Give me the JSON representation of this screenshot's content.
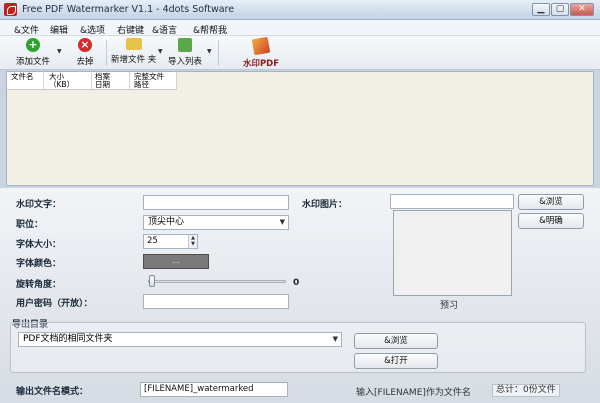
{
  "window": {
    "title": "Free PDF Watermarker V1.1 - 4dots Software",
    "min": "▁",
    "max": "▢",
    "close": "✕"
  },
  "menu": [
    "&文件",
    "编辑",
    "&选项",
    "右键键",
    "&语言",
    "&帮帮我"
  ],
  "toolbar": {
    "add_file": "添加文件",
    "remove": "去掉",
    "add_folder": "新增文件 夹",
    "import_list": "导入列表",
    "watermark_pdf": "水印PDF",
    "add_icon": "plus-icon",
    "remove_icon": "x-icon"
  },
  "filelist": {
    "columns": [
      "文件名",
      "大小（KB）",
      "档案日期",
      "完整文件路径"
    ]
  },
  "settings": {
    "watermark_text_label": "水印文字：",
    "watermark_text_value": "",
    "position_label": "职位：",
    "position_value": "顶尖中心",
    "font_size_label": "字体大小：",
    "font_size_value": "25",
    "font_color_label": "字体颜色：",
    "font_color_button": "...",
    "rotation_label": "旋转角度：",
    "rotation_value": "0",
    "user_password_label": "用户密码（开放）：",
    "user_password_value": "",
    "watermark_image_label": "水印图片：",
    "watermark_image_value": "",
    "browse_button": "&浏览",
    "clear_button": "&明确",
    "preview_caption": "预习"
  },
  "output": {
    "group_label": "导出目录",
    "folder_value": "PDF文档的相同文件夹",
    "browse_button": "&浏览",
    "open_button": "&打开",
    "filename_pattern_label": "输出文件名模式：",
    "filename_pattern_value": "[FILENAME]_watermarked",
    "hint": "输入[FILENAME]作为文件名",
    "total": "总计：0份文件"
  }
}
